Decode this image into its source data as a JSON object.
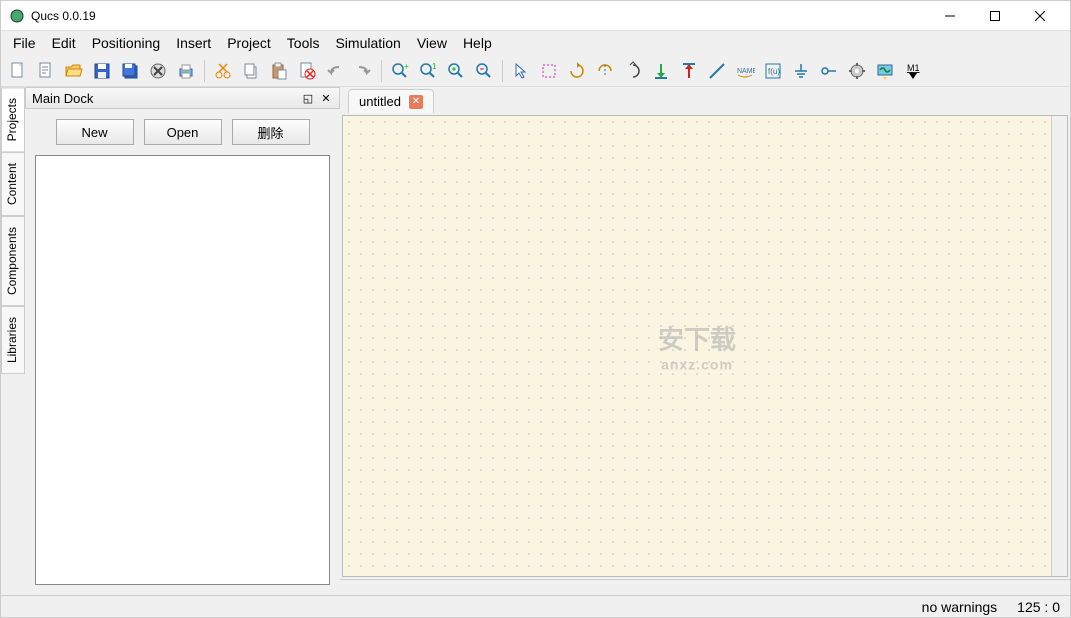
{
  "title": "Qucs 0.0.19",
  "menu": [
    "File",
    "Edit",
    "Positioning",
    "Insert",
    "Project",
    "Tools",
    "Simulation",
    "View",
    "Help"
  ],
  "dock": {
    "title": "Main Dock",
    "buttons": [
      "New",
      "Open",
      "删除"
    ]
  },
  "side_tabs": [
    "Projects",
    "Content",
    "Components",
    "Libraries"
  ],
  "document": {
    "tab_label": "untitled"
  },
  "watermark": {
    "main": "安下载",
    "sub": "anxz.com"
  },
  "status": {
    "warnings": "no warnings",
    "coords": "125 : 0"
  },
  "toolbar_icons": [
    "new-file",
    "new-text",
    "open",
    "save",
    "save-all",
    "delete",
    "print",
    "cut",
    "copy",
    "paste",
    "cancel-file",
    "undo",
    "redo",
    "zoom-in",
    "zoom-out",
    "zoom-plus",
    "zoom-minus",
    "pointer",
    "select-rect",
    "rotate-right",
    "flip-h",
    "flip-v",
    "move-down",
    "move-up",
    "wire",
    "name-label",
    "equation",
    "ground",
    "port",
    "settings",
    "simulate",
    "marker"
  ]
}
